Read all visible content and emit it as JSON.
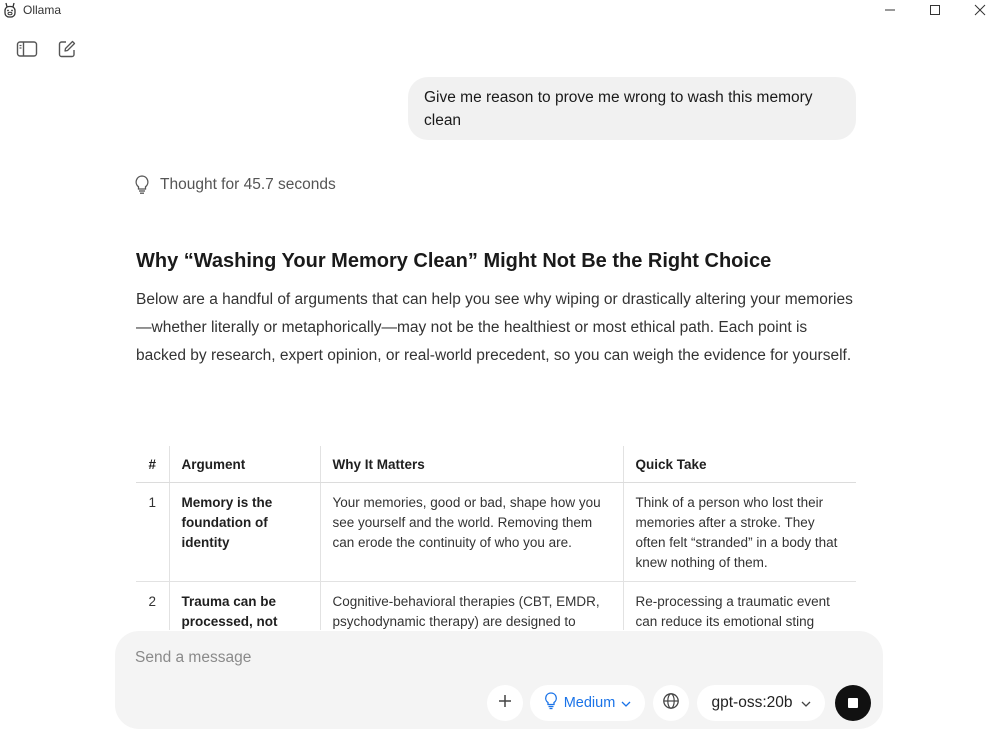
{
  "window": {
    "title": "Ollama"
  },
  "conversation": {
    "user_message": "Give me reason to prove me wrong to wash this memory clean",
    "thought_label": "Thought for 45.7 seconds",
    "heading": "Why “Washing Your Memory Clean” Might Not Be the Right Choice",
    "intro": "Below are a handful of arguments that can help you see why wiping or drastically altering your memories—whether literally or metaphorically—may not be the healthiest or most ethical path. Each point is backed by research, expert opinion, or real-world precedent, so you can weigh the evidence for yourself.",
    "table": {
      "headers": [
        "#",
        "Argument",
        "Why It Matters",
        "Quick Take"
      ],
      "rows": [
        {
          "num": "1",
          "argument": "Memory is the foundation of identity",
          "why": "Your memories, good or bad, shape how you see yourself and the world. Removing them can erode the continuity of who you are.",
          "take": "Think of a person who lost their memories after a stroke. They often felt “stranded” in a body that knew nothing of them."
        },
        {
          "num": "2",
          "argument": "Trauma can be processed, not",
          "why": "Cognitive-behavioral therapies (CBT, EMDR, psychodynamic therapy) are designed to",
          "take": "Re-processing a traumatic event can reduce its emotional sting"
        }
      ]
    }
  },
  "composer": {
    "placeholder": "Send a message",
    "effort_label": "Medium",
    "model_label": "gpt-oss:20b"
  },
  "colors": {
    "accent": "#1a73e8",
    "bubble": "#f1f1f1",
    "composer_bg": "#f4f4f4",
    "stop_button": "#111111"
  },
  "icons": {
    "app": "llama-icon",
    "sidebar": "sidebar-toggle-icon",
    "new_chat": "new-chat-icon",
    "thought": "lightbulb-icon",
    "add": "plus-icon",
    "effort": "lightbulb-icon",
    "web": "globe-icon",
    "stop": "stop-icon"
  }
}
